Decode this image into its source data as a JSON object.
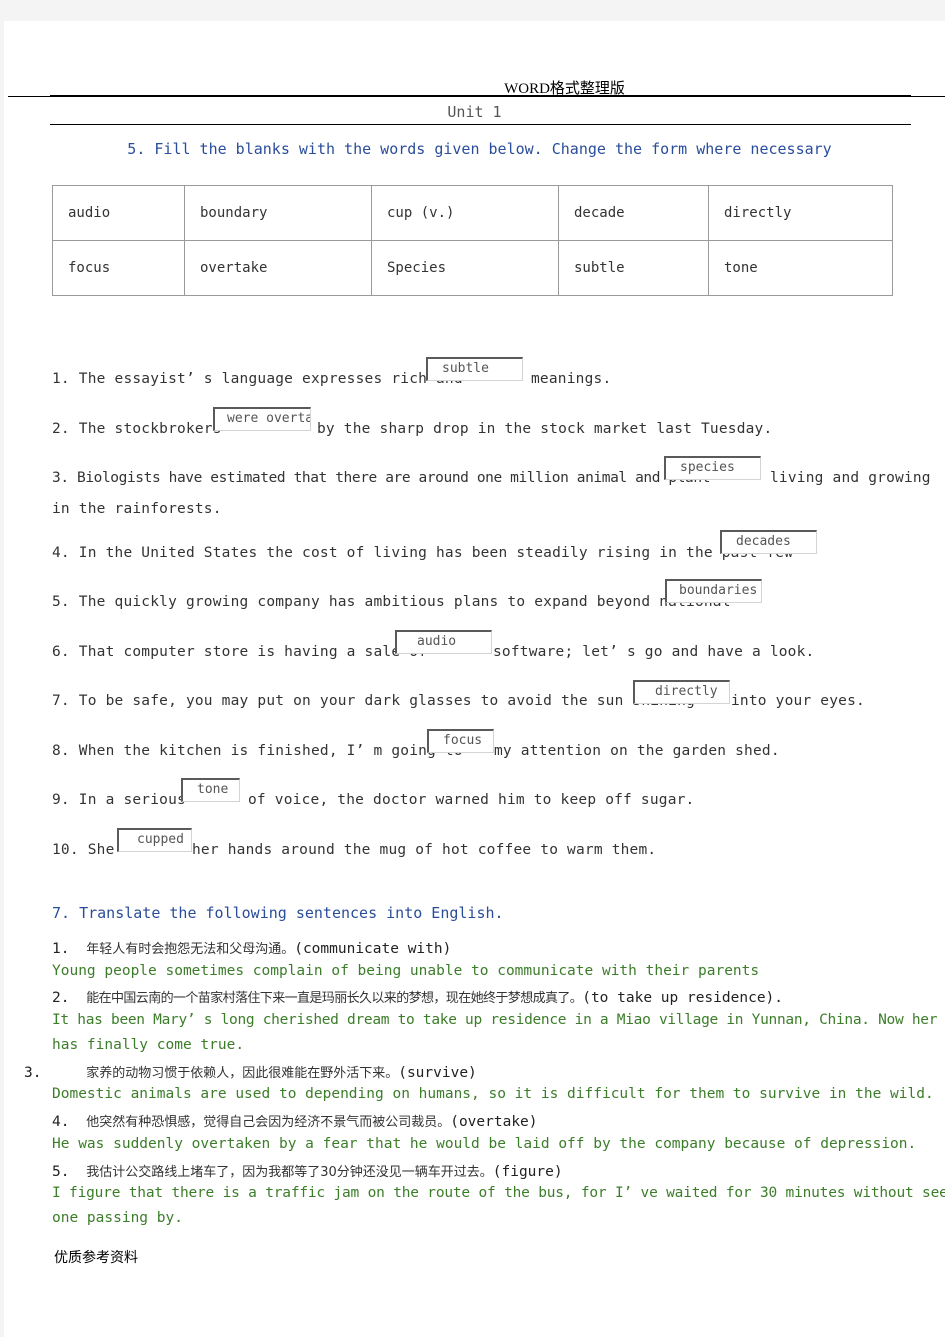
{
  "header": {
    "doc_title": "WORD格式整理版",
    "unit_title": "Unit 1"
  },
  "exercise5": {
    "heading": "5. Fill the blanks with the words given below. Change the form where necessary",
    "word_bank": [
      [
        "audio",
        "boundary",
        "cup (v.)",
        "decade",
        "directly"
      ],
      [
        "focus",
        "overtake",
        "Species",
        "subtle",
        "tone"
      ]
    ],
    "items": [
      {
        "before": "1. The essayist’ s language expresses rich and",
        "answer": "subtle",
        "after": "meanings."
      },
      {
        "before": "2. The stockbrokers",
        "answer": "were overtak",
        "after": "by the sharp drop in the stock market last Tuesday."
      },
      {
        "before": "3. Biologists have estimated that there are around one million animal and plant",
        "answer": "species",
        "after": "living and growing",
        "continuation": "in the rainforests."
      },
      {
        "before": "4. In the United States the cost of living has been steadily rising in the past few",
        "answer": "decades",
        "after": ""
      },
      {
        "before": "5. The quickly growing company has ambitious plans to expand beyond national",
        "answer": "boundaries",
        "after": ""
      },
      {
        "before": "6. That computer store is having a sale of",
        "answer": "audio",
        "after": "software; let’ s go and have a look."
      },
      {
        "before": "7. To be safe, you may put on your dark glasses to avoid the sun shining",
        "answer": "directly",
        "after": "into your eyes."
      },
      {
        "before": "8. When the kitchen is finished, I’ m going to",
        "answer": "focus",
        "after": "my attention on the garden shed."
      },
      {
        "before": "9. In a serious",
        "answer": "tone",
        "after": "of voice, the doctor warned him to keep off sugar."
      },
      {
        "before": "10. She",
        "answer": "cupped",
        "after": "her hands around the mug of hot coffee to warm them."
      }
    ]
  },
  "exercise7": {
    "heading": "7. Translate the following sentences into English.",
    "items": [
      {
        "num": "1.",
        "chinese": "年轻人有时会抱怨无法和父母沟通。",
        "hint": "(communicate with)",
        "english": [
          "Young people sometimes complain of being unable to communicate with their parents"
        ]
      },
      {
        "num": "2.",
        "chinese": "能在中国云南的一个苗家村落住下来一直是玛丽长久以来的梦想，现在她终于梦想成真了。",
        "hint": "(to take up residence).",
        "english": [
          "It has been Mary’ s long cherished dream to take up residence in a Miao village in Yunnan, China. Now her dream",
          "has finally come true."
        ]
      },
      {
        "num": "3.",
        "chinese": "家养的动物习惯于依赖人，因此很难能在野外活下来。",
        "hint": "(survive)",
        "english": [
          "Domestic animals are used to depending on humans, so it is difficult for them to survive in the wild."
        ]
      },
      {
        "num": "4.",
        "chinese": "他突然有种恐惧感，觉得自己会因为经济不景气而被公司裁员。",
        "hint": "(overtake)",
        "english": [
          "He was suddenly overtaken by a fear that he would be laid off by the company because of depression."
        ]
      },
      {
        "num": "5.",
        "chinese": "我估计公交路线上堵车了，因为我都等了30分钟还没见一辆车开过去。",
        "hint": "(figure)",
        "english": [
          "I figure that there is a traffic jam on the route of the bus, for I’ ve waited for 30 minutes without seeing",
          "one passing by."
        ]
      }
    ]
  },
  "footer": {
    "text": "优质参考资料"
  }
}
